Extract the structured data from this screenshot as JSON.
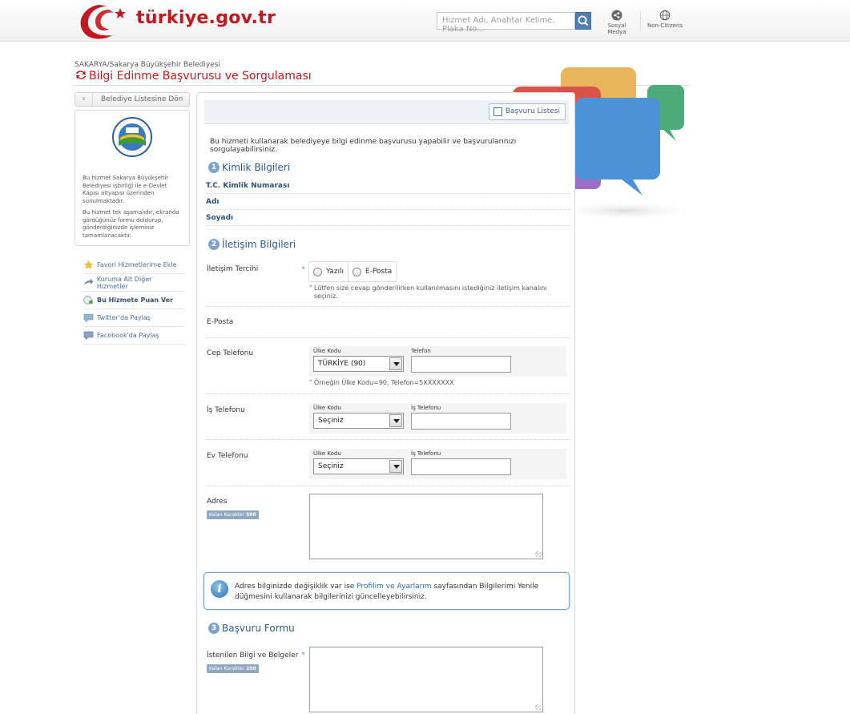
{
  "header": {
    "logo_text": "türkiye.gov.tr",
    "search_placeholder": "Hizmet Adı, Anahtar Kelime, Plaka No...",
    "social_label": "Sosyal Medya",
    "non_citizens_label": "Non-Citizens"
  },
  "page": {
    "breadcrumb": "SAKARYA/Sakarya Büyükşehir Belediyesi",
    "title": "Bilgi Edinme Başvurusu ve Sorgulaması"
  },
  "sidebar": {
    "back_label": "Belediye Listesine Dön",
    "desc_1": "Bu hizmet Sakarya Büyükşehir Belediyesi işbirliği ile e-Devlet Kapısı altyapısı üzerinden sunulmaktadır.",
    "desc_2": "Bu hizmet tek aşamalıdır, ekranda gördüğünüz formu doldurup, gönderdiğinizde işleminiz tamamlanacaktır.",
    "links": [
      {
        "label": "Favori Hizmetlerime Ekle",
        "icon": "star-icon"
      },
      {
        "label": "Kuruma Ait Diğer Hizmetler",
        "icon": "share-arrow-icon"
      },
      {
        "label": "Bu Hizmete Puan Ver",
        "icon": "rating-icon"
      },
      {
        "label": "Twitter'da Paylaş",
        "icon": "twitter-icon"
      },
      {
        "label": "Facebook'da Paylaş",
        "icon": "facebook-icon"
      }
    ]
  },
  "main": {
    "list_button": "Başvuru Listesi",
    "intro": "Bu hizmeti kullanarak belediyeye bilgi edinme başvurusu yapabilir ve başvurularınızı sorgulayabilirsiniz.",
    "section1": {
      "num": "1",
      "title": "Kimlik Bilgileri"
    },
    "identity_rows": [
      "T.C. Kimlik Numarası",
      "Adı",
      "Soyadı"
    ],
    "section2": {
      "num": "2",
      "title": "İletişim Bilgileri"
    },
    "contact_pref_label": "İletişim Tercihi",
    "contact_options": [
      "Yazılı",
      "E-Posta"
    ],
    "contact_hint": "Lütfen size cevap gönderilirken kullanılmasını istediğiniz iletişim kanalını seçiniz.",
    "email_label": "E-Posta",
    "mobile_label": "Cep Telefonu",
    "country_code_label": "Ülke Kodu",
    "phone_label": "Telefon",
    "mobile_country_value": "TÜRKİYE (90)",
    "mobile_hint": "Örneğin Ülke Kodu=90, Telefon=5XXXXXXX",
    "work_label": "İş Telefonu",
    "work_phone_label": "İş Telefonu",
    "work_country_value": "Seçiniz",
    "home_label": "Ev Telefonu",
    "home_phone_label": "İş Telefonu",
    "home_country_value": "Seçiniz",
    "address_label": "Adres",
    "address_counter_label": "Kalan Karakter",
    "address_counter_value": "500",
    "info_before": "Adres bilginizde değişiklik var ise ",
    "info_link": "Profilim ve Ayarlarım",
    "info_after": " sayfasından Bilgilerimi Yenile düğmesini kullanarak bilgilerinizi güncelleyebilirsiniz.",
    "section3": {
      "num": "3",
      "title": "Başvuru Formu"
    },
    "request_label": "İstenilen Bilgi ve Belgeler",
    "request_counter_label": "Kalan Karakter",
    "request_counter_value": "250"
  },
  "colors": {
    "brand_red": "#c5161d",
    "link_blue": "#2b6cb0",
    "section_blue": "#2d5a8c"
  }
}
